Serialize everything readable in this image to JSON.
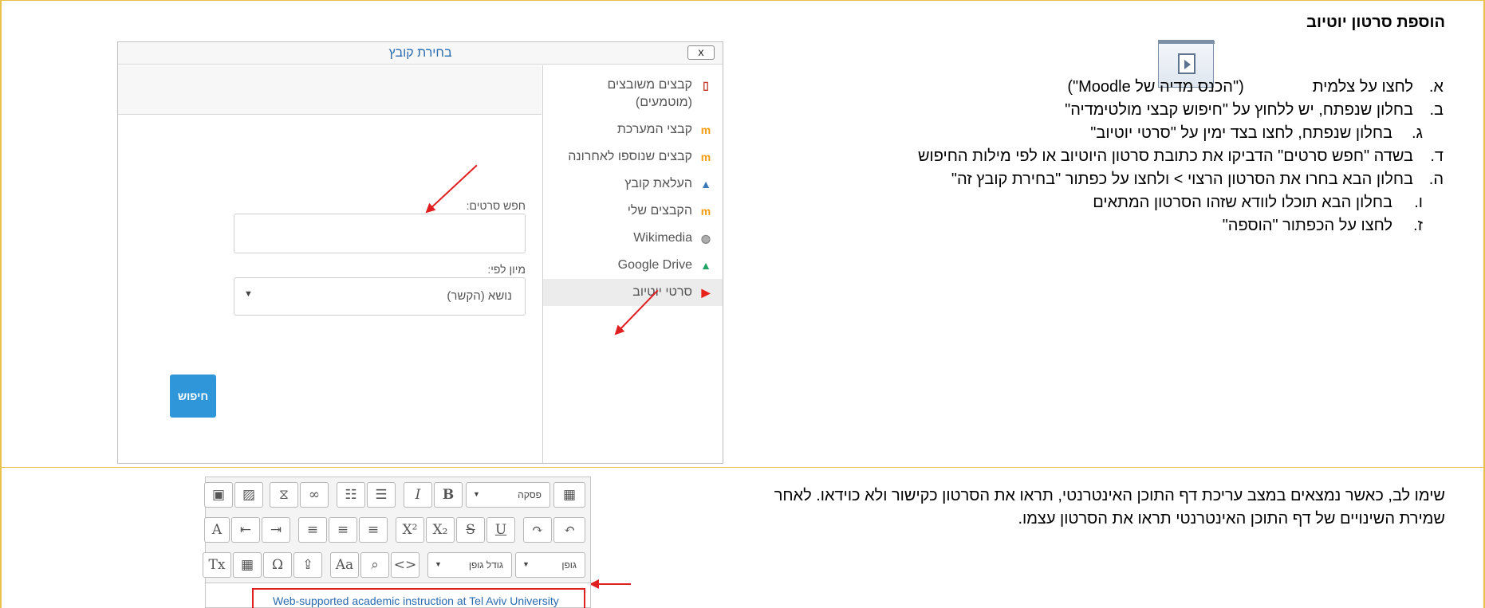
{
  "heading": "הוספת סרטון יוטיוב",
  "steps": [
    {
      "marker": "א.",
      "before": "לחצו על צלמית",
      "after": "(\"הכנס מדיה של Moodle\")"
    },
    {
      "marker": "ב.",
      "text": "בחלון שנפתח, יש ללחוץ על \"חיפוש קבצי מולטימדיה\""
    },
    {
      "marker": "ג.",
      "text": "בחלון שנפתח, לחצו בצד ימין על \"סרטי יוטיוב\""
    },
    {
      "marker": "ד.",
      "text": "בשדה \"חפש סרטים\" הדביקו את כתובת סרטון היוטיוב או לפי מילות החיפוש"
    },
    {
      "marker": "ה.",
      "text": "בחלון הבא בחרו את הסרטון הרצוי > ולחצו על כפתור \"בחירת קובץ זה\""
    },
    {
      "marker": "ו.",
      "text": "בחלון הבא תוכלו לוודא שזהו הסרטון המתאים"
    },
    {
      "marker": "ז.",
      "text": "לחצו על הכפתור \"הוספה\""
    }
  ],
  "note": "שימו לב, כאשר נמצאים במצב עריכת דף התוכן האינטרנטי, תראו את הסרטון כקישור ולא כוידאו. לאחר שמירת השינויים של דף התוכן האינטרנטי תראו את הסרטון עצמו.",
  "dialog": {
    "title": "בחירת קובץ",
    "close_label": "x",
    "repositories": [
      {
        "label": "קבצים משובצים (מוטמעים)",
        "icon": "embedded-files-icon",
        "glyph": "▯",
        "color": "#c0392b"
      },
      {
        "label": "קבצי המערכת",
        "icon": "moodle-icon",
        "glyph": "m",
        "color": "#f39c12"
      },
      {
        "label": "קבצים שנוספו לאחרונה",
        "icon": "moodle-icon",
        "glyph": "m",
        "color": "#f39c12"
      },
      {
        "label": "העלאת קובץ",
        "icon": "upload-icon",
        "glyph": "▲",
        "color": "#3a7ab8"
      },
      {
        "label": "הקבצים שלי",
        "icon": "moodle-icon",
        "glyph": "m",
        "color": "#f39c12"
      },
      {
        "label": "Wikimedia",
        "icon": "wikimedia-icon",
        "glyph": "◍",
        "color": "#888888"
      },
      {
        "label": "Google Drive",
        "icon": "google-drive-icon",
        "glyph": "▲",
        "color": "#1fa463"
      },
      {
        "label": "סרטי יוטיוב",
        "icon": "youtube-icon",
        "glyph": "▶",
        "color": "#e62117"
      }
    ],
    "search_label": "חפש סרטים:",
    "search_value": "",
    "sort_label": "מיון לפי:",
    "sort_value": "נושא (הקשר)",
    "search_button": "חיפוש"
  },
  "editor": {
    "paragraph_dropdown": "פסקה",
    "font_size_dropdown": "גודל גופן",
    "font_dropdown": "גופן",
    "link_text": "Web-supported academic instruction at Tel Aviv University"
  },
  "colors": {
    "frame": "#e8c14a",
    "accent_blue": "#2f96d9",
    "arrow_red": "#e02020"
  }
}
